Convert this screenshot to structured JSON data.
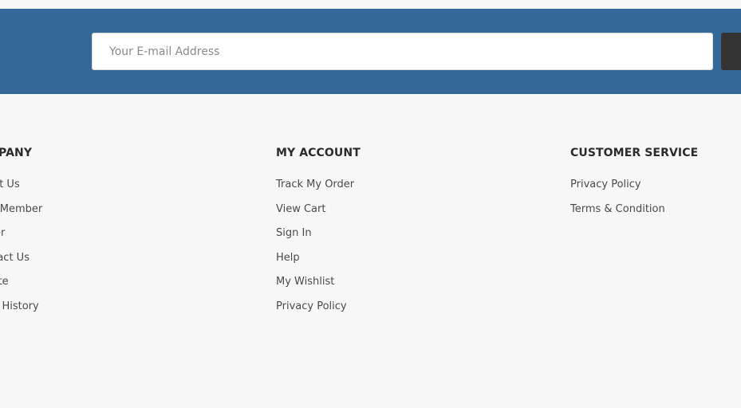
{
  "newsletter": {
    "email_placeholder": "Your E-mail Address"
  },
  "colors": {
    "band": "#336899",
    "page_background": "#f7f7f7",
    "button": "#333333"
  },
  "footer": {
    "company": {
      "heading": "MPANY",
      "links": [
        "out Us",
        "m Member",
        "eer",
        "ntact Us",
        "iate",
        "er History"
      ]
    },
    "my_account": {
      "heading": "MY ACCOUNT",
      "links": [
        "Track My Order",
        "View Cart",
        "Sign In",
        "Help",
        "My Wishlist",
        "Privacy Policy"
      ]
    },
    "customer_service": {
      "heading": "CUSTOMER SERVICE",
      "links": [
        "Privacy Policy",
        "Terms & Condition"
      ]
    }
  }
}
